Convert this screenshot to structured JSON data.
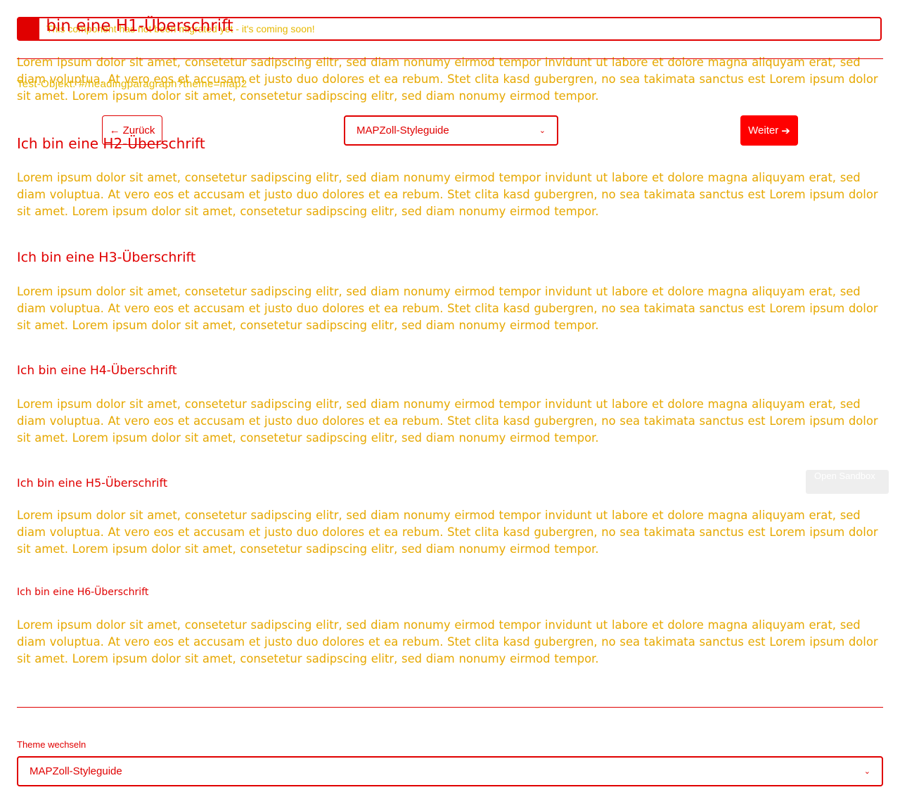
{
  "banner": {
    "text": "This component has not been migrated yet - it's coming soon!",
    "icon": "warning-icon"
  },
  "headings": {
    "h1": "Ich bin eine H1-Überschrift",
    "h2": "Ich bin eine H2-Überschrift",
    "h3": "Ich bin eine H3-Überschrift",
    "h4": "Ich bin eine H4-Überschrift",
    "h5": "Ich bin eine H5-Überschrift",
    "h6": "Ich bin eine H6-Überschrift"
  },
  "test_object": {
    "label": "Test-Objekt:",
    "value": "#/headingparagraph?theme=map2"
  },
  "paragraph": "Lorem ipsum dolor sit amet, consetetur sadipscing elitr, sed diam nonumy eirmod tempor invidunt ut labore et dolore magna aliquyam erat, sed diam voluptua. At vero eos et accusam et justo duo dolores et ea rebum. Stet clita kasd gubergren, no sea takimata sanctus est Lorem ipsum dolor sit amet. Lorem ipsum dolor sit amet, consetetur sadipscing elitr, sed diam nonumy eirmod tempor.",
  "nav": {
    "back_label": "Zurück",
    "back_icon": "arrow-left-icon",
    "guide_select_value": "MAPZoll-Styleguide",
    "next_label": "Weiter",
    "next_icon": "arrow-right-icon"
  },
  "sandbox": {
    "label": "Open Sandbox"
  },
  "theme_switcher": {
    "label": "Theme wechseln",
    "value": "MAPZoll-Styleguide"
  },
  "colors": {
    "accent": "#e00000",
    "text_yellow": "#e6a800",
    "button_red": "#ff0000"
  }
}
